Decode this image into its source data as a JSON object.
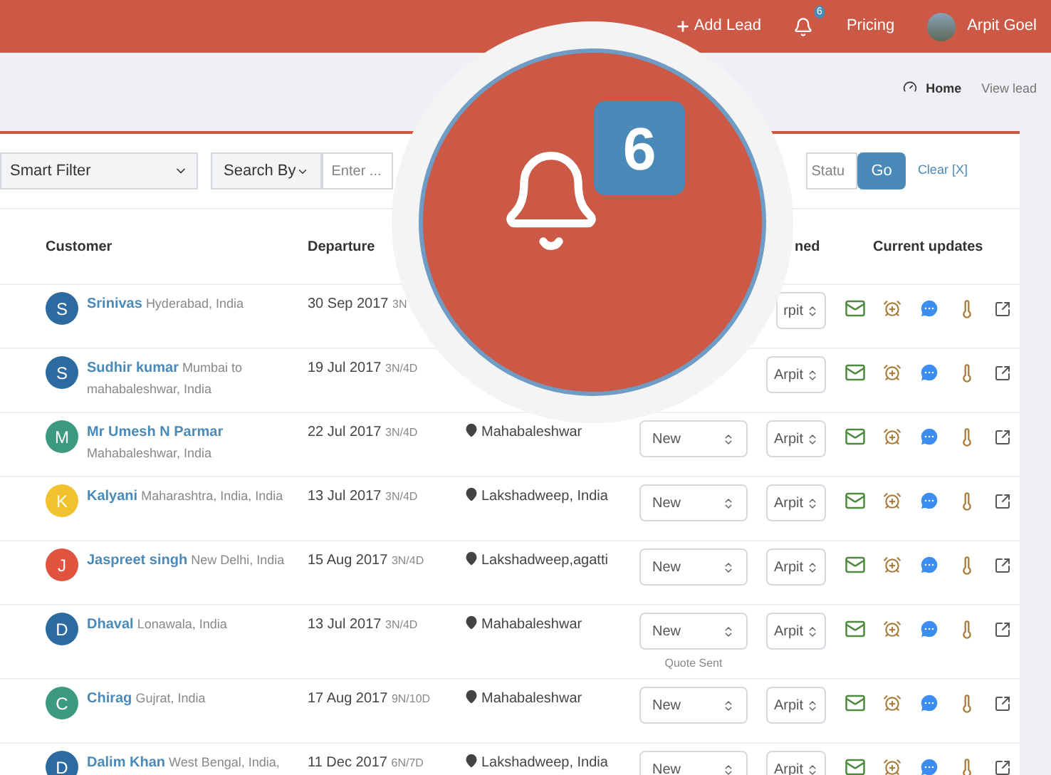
{
  "header": {
    "add_lead": "Add Lead",
    "notification_count": "6",
    "pricing": "Pricing",
    "user_name": "Arpit Goel"
  },
  "breadcrumb": {
    "home": "Home",
    "current": "View lead"
  },
  "filters": {
    "smart_filter": "Smart Filter",
    "search_by": "Search By",
    "search_placeholder": "Enter ...",
    "status_placeholder": "Statu",
    "go": "Go",
    "clear": "Clear [X]"
  },
  "table": {
    "columns": [
      "Customer",
      "Departure",
      "ned",
      "Current updates"
    ],
    "rows": [
      {
        "initial": "S",
        "color": "#2c6aa0",
        "name": "Srinivas",
        "place": "Hyderabad, India",
        "date": "30 Sep 2017",
        "duration": "3N",
        "assigned": "rpit"
      },
      {
        "initial": "S",
        "color": "#2c6aa0",
        "name": "Sudhir kumar",
        "place": "Mumbai to mahabaleshwar, India",
        "date": "19 Jul 2017",
        "duration": "3N/4D",
        "assigned": "Arpit"
      },
      {
        "initial": "M",
        "color": "#3e9a7e",
        "name": "Mr Umesh N Parmar",
        "place": "Mahabaleshwar, India",
        "date": "22 Jul 2017",
        "duration": "3N/4D",
        "destination": "Mahabaleshwar",
        "status": "New",
        "assigned": "Arpit"
      },
      {
        "initial": "K",
        "color": "#f2c12e",
        "name": "Kalyani",
        "place": "Maharashtra, India, India",
        "date": "13 Jul 2017",
        "duration": "3N/4D",
        "destination": "Lakshadweep, India",
        "status": "New",
        "assigned": "Arpit"
      },
      {
        "initial": "J",
        "color": "#e0533f",
        "name": "Jaspreet singh",
        "place": "New Delhi, India",
        "date": "15 Aug 2017",
        "duration": "3N/4D",
        "destination": "Lakshadweep,agatti",
        "status": "New",
        "assigned": "Arpit"
      },
      {
        "initial": "D",
        "color": "#2c6aa0",
        "name": "Dhaval",
        "place": "Lonawala, India",
        "date": "13 Jul 2017",
        "duration": "3N/4D",
        "destination": "Mahabaleshwar",
        "status": "New",
        "note": "Quote Sent",
        "assigned": "Arpit"
      },
      {
        "initial": "C",
        "color": "#3e9a7e",
        "name": "Chirag",
        "place": "Gujrat, India",
        "date": "17 Aug 2017",
        "duration": "9N/10D",
        "destination": "Mahabaleshwar",
        "status": "New",
        "assigned": "Arpit"
      },
      {
        "initial": "D",
        "color": "#2c6aa0",
        "name": "Dalim Khan",
        "place": "West Bengal, India,",
        "date": "11 Dec 2017",
        "duration": "6N/7D",
        "destination": "Lakshadweep, India",
        "status": "New",
        "assigned": "Arpit"
      }
    ]
  },
  "magnifier": {
    "badge": "6"
  }
}
